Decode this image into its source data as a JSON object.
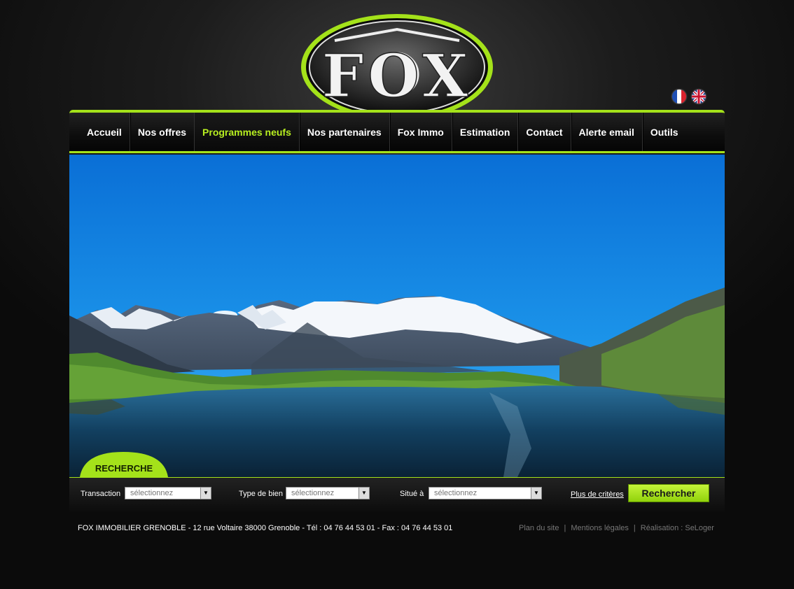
{
  "logo": {
    "text": "FOX"
  },
  "languages": [
    {
      "name": "Français",
      "icon": "flag-fr-icon"
    },
    {
      "name": "English",
      "icon": "flag-uk-icon"
    }
  ],
  "nav": {
    "items": [
      {
        "label": "Accueil"
      },
      {
        "label": "Nos offres"
      },
      {
        "label": "Programmes neufs",
        "active": true
      },
      {
        "label": "Nos partenaires"
      },
      {
        "label": "Fox Immo"
      },
      {
        "label": "Estimation"
      },
      {
        "label": "Contact"
      },
      {
        "label": "Alerte email"
      },
      {
        "label": "Outils"
      }
    ]
  },
  "search": {
    "tab_label": "RECHERCHE",
    "transaction": {
      "label": "Transaction",
      "value": "sélectionnez"
    },
    "type_bien": {
      "label": "Type de bien",
      "value": "sélectionnez"
    },
    "situe": {
      "label": "Situé à",
      "value": "sélectionnez"
    },
    "more_criteria": "Plus de critères",
    "submit": "Rechercher"
  },
  "footer": {
    "address": "FOX IMMOBILIER GRENOBLE - 12 rue Voltaire 38000 Grenoble - Tél : 04 76 44 53 01 - Fax : 04 76 44 53 01",
    "links": [
      "Plan du site",
      "Mentions légales",
      "Réalisation : SeLoger"
    ]
  },
  "colors": {
    "accent": "#a4e21a",
    "active_nav": "#b8f020",
    "background": "#111111"
  }
}
